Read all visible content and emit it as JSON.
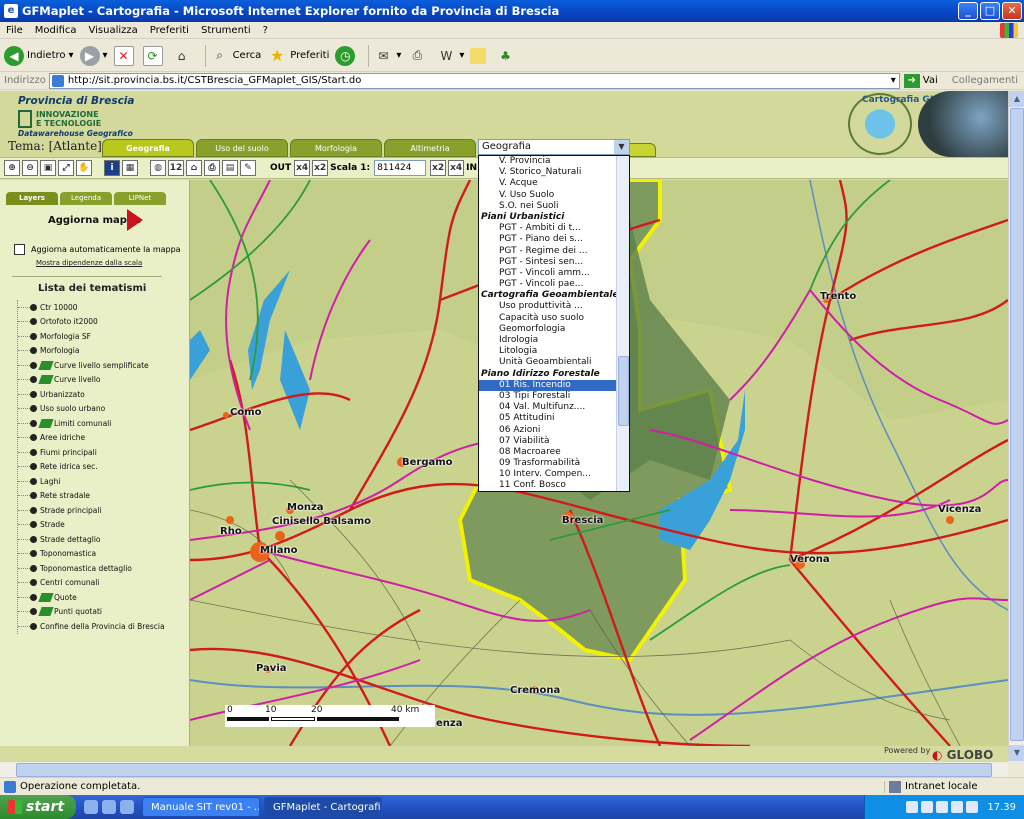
{
  "window": {
    "title": "GFMaplet - Cartografia - Microsoft Internet Explorer fornito da Provincia di Brescia",
    "minimize": "_",
    "maximize": "□",
    "close": "✕"
  },
  "menu": [
    "File",
    "Modifica",
    "Visualizza",
    "Preferiti",
    "Strumenti",
    "?"
  ],
  "toolbar": {
    "back": "Indietro",
    "search": "Cerca",
    "favorites": "Preferiti"
  },
  "address": {
    "label": "Indirizzo",
    "url": "http://sit.provincia.bs.it/CSTBrescia_GFMaplet_GIS/Start.do",
    "go": "Vai",
    "links": "Collegamenti"
  },
  "header": {
    "province": "Provincia di Brescia",
    "innovation_line1": "INNOVAZIONE",
    "innovation_line2": "E TECNOLOGIE",
    "datawarehouse": "Datawarehouse Geografico",
    "carto_logo_text": "Cartografia GIS",
    "tema_label": "Tema: [Atlante]"
  },
  "tabs": [
    "Geografia",
    "Uso del suolo",
    "Morfologia",
    "Altimetria"
  ],
  "theme_select": {
    "value": "Geografia",
    "options": [
      {
        "label": "V. Provincia",
        "group": false
      },
      {
        "label": "V. Storico_Naturali",
        "group": false
      },
      {
        "label": "V. Acque",
        "group": false
      },
      {
        "label": "V. Uso Suolo",
        "group": false
      },
      {
        "label": "S.O. nei Suoli",
        "group": false
      },
      {
        "label": "Piani Urbanistici",
        "group": true
      },
      {
        "label": "PGT - Ambiti di t...",
        "group": false
      },
      {
        "label": "PGT - Piano dei s...",
        "group": false
      },
      {
        "label": "PGT - Regime dei ...",
        "group": false
      },
      {
        "label": "PGT - Sintesi sen...",
        "group": false
      },
      {
        "label": "PGT - Vincoli amm...",
        "group": false
      },
      {
        "label": "PGT - Vincoli pae...",
        "group": false
      },
      {
        "label": "Cartografia Geoambientale",
        "group": true
      },
      {
        "label": "Uso produttività ...",
        "group": false
      },
      {
        "label": "Capacità uso suolo",
        "group": false
      },
      {
        "label": "Geomorfologia",
        "group": false
      },
      {
        "label": "Idrologia",
        "group": false
      },
      {
        "label": "Litologia",
        "group": false
      },
      {
        "label": "Unità Geoambientali",
        "group": false
      },
      {
        "label": "Piano Idirizzo Forestale",
        "group": true
      },
      {
        "label": "01 Ris. Incendio",
        "group": false,
        "selected": true
      },
      {
        "label": "03 Tipi Forestali",
        "group": false
      },
      {
        "label": "04 Val. Multifunz....",
        "group": false
      },
      {
        "label": "05 Attitudini",
        "group": false
      },
      {
        "label": "06 Azioni",
        "group": false
      },
      {
        "label": "07 Viabilità",
        "group": false
      },
      {
        "label": "08 Macroaree",
        "group": false
      },
      {
        "label": "09 Trasformabilità",
        "group": false
      },
      {
        "label": "10 Interv. Compen...",
        "group": false
      },
      {
        "label": "11 Conf. Bosco",
        "group": false
      }
    ]
  },
  "map_toolbar": {
    "out_label": "OUT",
    "scale_label": "Scala 1:",
    "scale_value": "811424",
    "in_label": "IN",
    "zoom_x4": "x4",
    "zoom_x2": "x2",
    "info_icon_text": "i",
    "badge_12": "12"
  },
  "left_panel": {
    "tabs": [
      "Layers",
      "Legenda",
      "LIPNet"
    ],
    "update_button": "Aggiorna mappa",
    "auto_update": "Aggiorna automaticamente la mappa",
    "scale_dependencies": "Mostra dipendenze dalla scala",
    "list_title": "Lista dei tematismi",
    "layers": [
      {
        "label": "Ctr 10000",
        "legend": false
      },
      {
        "label": "Ortofoto it2000",
        "legend": false
      },
      {
        "label": "Morfologia SF",
        "legend": false
      },
      {
        "label": "Morfologia",
        "legend": false
      },
      {
        "label": "Curve livello semplificate",
        "legend": true
      },
      {
        "label": "Curve livello",
        "legend": true
      },
      {
        "label": "Urbanizzato",
        "legend": false
      },
      {
        "label": "Uso suolo urbano",
        "legend": false
      },
      {
        "label": "Limiti comunali",
        "legend": true
      },
      {
        "label": "Aree idriche",
        "legend": false
      },
      {
        "label": "Fiumi principali",
        "legend": false
      },
      {
        "label": "Rete idrica sec.",
        "legend": false
      },
      {
        "label": "Laghi",
        "legend": false
      },
      {
        "label": "Rete stradale",
        "legend": false
      },
      {
        "label": "Strade principali",
        "legend": false
      },
      {
        "label": "Strade",
        "legend": false
      },
      {
        "label": "Strade dettaglio",
        "legend": false
      },
      {
        "label": "Toponomastica",
        "legend": false
      },
      {
        "label": "Toponomastica dettaglio",
        "legend": false
      },
      {
        "label": "Centri comunali",
        "legend": false
      },
      {
        "label": "Quote",
        "legend": true
      },
      {
        "label": "Punti quotati",
        "legend": true
      },
      {
        "label": "Confine della Provincia di Brescia",
        "legend": false
      }
    ]
  },
  "map": {
    "cities": [
      "Trento",
      "Como",
      "Bergamo",
      "Monza",
      "Cinisello Balsamo",
      "Rho",
      "Milano",
      "Brescia",
      "Verona",
      "Vicenza",
      "Pavia",
      "Cremona",
      "enza"
    ],
    "scale_labels": [
      "0",
      "10",
      "20",
      "40 km"
    ]
  },
  "footer": {
    "powered_by": "Powered by",
    "globo": "GLOBO"
  },
  "status": {
    "text": "Operazione completata.",
    "zone": "Intranet locale"
  },
  "taskbar": {
    "start": "start",
    "tasks": [
      "Manuale SIT rev01 - ...",
      "GFMaplet - Cartografi..."
    ],
    "clock": "17.39"
  },
  "colors": {
    "title_blue": "#0a5fdb",
    "page_olive": "#d2d99a",
    "tab_green": "#8aa02c",
    "selected_option": "#316ac5",
    "province_border": "#f2f200",
    "road_red": "#d11a1a",
    "road_magenta": "#d01fa6",
    "water_blue": "#3aa0d8"
  }
}
